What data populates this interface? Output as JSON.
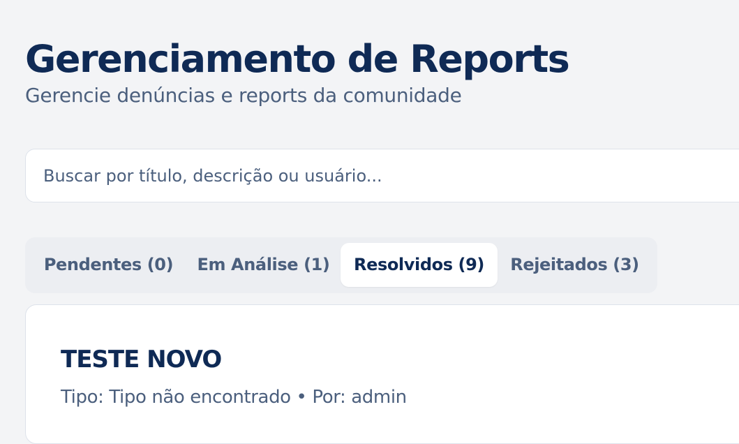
{
  "header": {
    "title": "Gerenciamento de Reports",
    "subtitle": "Gerencie denúncias e reports da comunidade"
  },
  "search": {
    "placeholder": "Buscar por título, descrição ou usuário...",
    "value": ""
  },
  "tabs": [
    {
      "label": "Pendentes (0)",
      "active": false
    },
    {
      "label": "Em Análise (1)",
      "active": false
    },
    {
      "label": "Resolvidos (9)",
      "active": true
    },
    {
      "label": "Rejeitados (3)",
      "active": false
    }
  ],
  "reports": [
    {
      "title": "TESTE NOVO",
      "meta": "Tipo: Tipo não encontrado • Por: admin"
    }
  ],
  "colors": {
    "background": "#f3f4f6",
    "title": "#0f2a55",
    "muted_text": "#4b5f7d",
    "surface": "#ffffff",
    "tab_track": "#eceef2"
  }
}
